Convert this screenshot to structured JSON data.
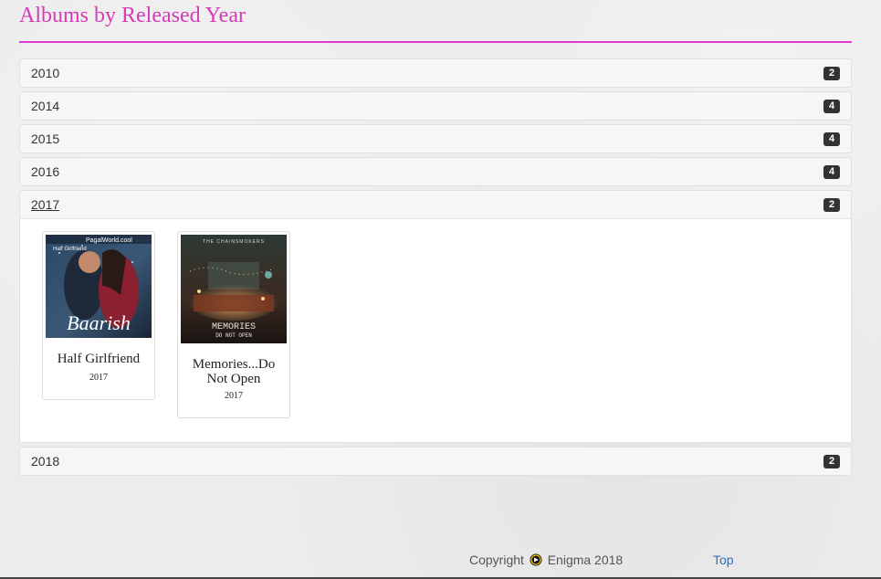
{
  "page": {
    "title": "Albums by Released Year"
  },
  "years": [
    {
      "label": "2010",
      "count": "2"
    },
    {
      "label": "2014",
      "count": "4"
    },
    {
      "label": "2015",
      "count": "4"
    },
    {
      "label": "2016",
      "count": "4"
    },
    {
      "label": "2017",
      "count": "2"
    },
    {
      "label": "2018",
      "count": "2"
    }
  ],
  "open_year": {
    "albums": [
      {
        "name": "Half Girlfriend",
        "year": "2017",
        "cover_text": "Baarish",
        "cover_small_text": "Half Girlfriend",
        "watermark": "PagalWorld.cool"
      },
      {
        "name": "Memories...Do Not Open",
        "year": "2017",
        "cover_text": "MEMORIES",
        "cover_sub_text": "DO NOT OPEN",
        "cover_top_text": "THE CHAINSMOKERS"
      }
    ]
  },
  "footer": {
    "copyright": "Copyright",
    "brand": "Enigma 2018",
    "top_link": "Top"
  },
  "colors": {
    "accent": "#d63ab8",
    "link": "#2a6fbf",
    "badge": "#333333"
  }
}
